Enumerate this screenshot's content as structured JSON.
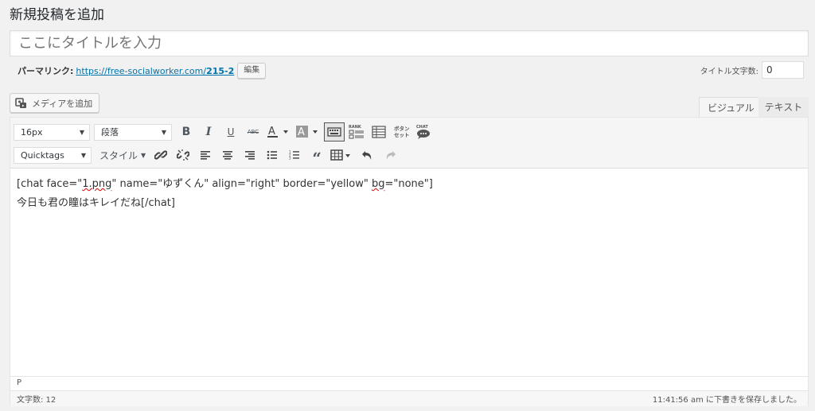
{
  "page": {
    "title": "新規投稿を追加"
  },
  "post_title": {
    "placeholder": "ここにタイトルを入力"
  },
  "permalink": {
    "label": "パーマリンク:",
    "url": "https://free-socialworker.com/",
    "slug": "215-2",
    "edit_label": "編集"
  },
  "title_count": {
    "label": "タイトル文字数:",
    "value": "0"
  },
  "media": {
    "add_label": "メディアを追加"
  },
  "tabs": {
    "visual": "ビジュアル",
    "text": "テキスト"
  },
  "toolbar": {
    "font_size": "16px",
    "paragraph": "段落",
    "quicktags": "Quicktags",
    "style": "スタイル",
    "rank_label": "RANK",
    "button_label_1": "ボタン",
    "button_label_2": "セット",
    "chat_label": "CHAT"
  },
  "content": {
    "line1_pre": "[chat face=\"",
    "line1_file": "1.png",
    "line1_mid": "\" name=\"ゆずくん\" align=\"right\" border=\"yellow\" ",
    "line1_bg": "bg",
    "line1_post": "=\"none\"]",
    "line2": "今日も君の瞳はキレイだね[/chat]"
  },
  "path": "P",
  "status": {
    "word_count": "文字数: 12",
    "draft_saved": "11:41:56 am に下書きを保存しました。"
  }
}
